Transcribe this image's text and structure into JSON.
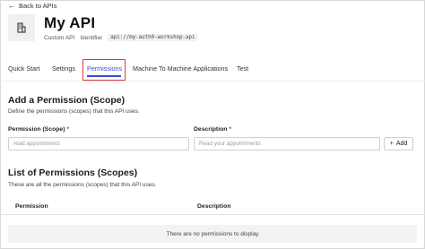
{
  "nav": {
    "back_label": "Back to APIs"
  },
  "api": {
    "name": "My API",
    "type": "Custom API",
    "identifier_label": "Identifier",
    "identifier_value": "api://my-auth0-workshop-api"
  },
  "tabs": [
    {
      "label": "Quick Start",
      "active": false
    },
    {
      "label": "Settings",
      "active": false
    },
    {
      "label": "Permissions",
      "active": true
    },
    {
      "label": "Machine To Machine Applications",
      "active": false
    },
    {
      "label": "Test",
      "active": false
    }
  ],
  "add_permission": {
    "title": "Add a Permission (Scope)",
    "description": "Define the permissions (scopes) that this API uses.",
    "permission_label": "Permission (Scope)",
    "permission_placeholder": "read:appointments",
    "description_label": "Description",
    "description_placeholder": "Read your appointments",
    "add_button": "Add"
  },
  "permissions_list": {
    "title": "List of Permissions (Scopes)",
    "description": "These are all the permissions (scopes) that this API uses.",
    "columns": [
      "Permission",
      "Description"
    ],
    "empty_message": "There are no permissions to display"
  },
  "colors": {
    "accent": "#3c4bd6",
    "highlight": "#e03a3a",
    "required": "#d0312d"
  }
}
